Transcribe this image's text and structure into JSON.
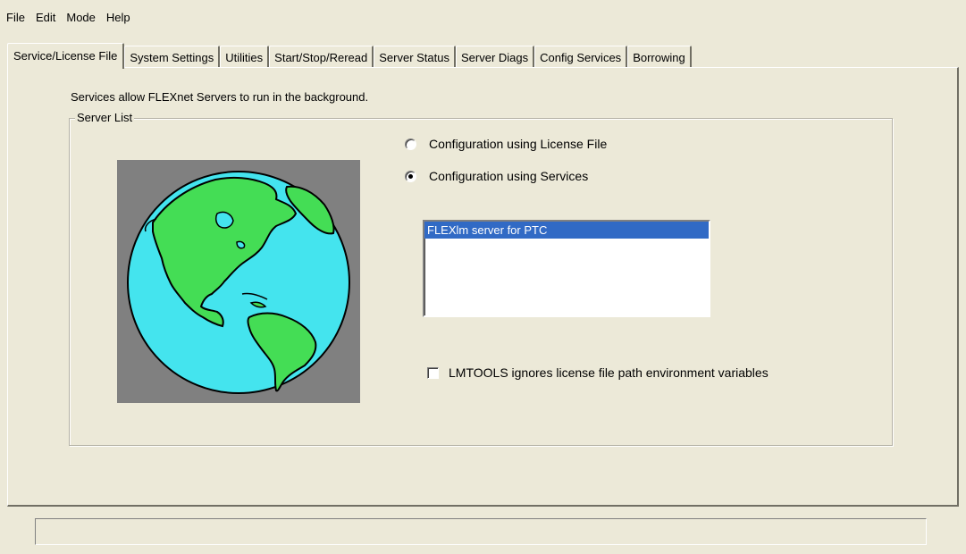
{
  "menu": {
    "file": "File",
    "edit": "Edit",
    "mode": "Mode",
    "help": "Help"
  },
  "tabs": [
    {
      "label": "Service/License File",
      "active": true
    },
    {
      "label": "System Settings",
      "active": false
    },
    {
      "label": "Utilities",
      "active": false
    },
    {
      "label": "Start/Stop/Reread",
      "active": false
    },
    {
      "label": "Server Status",
      "active": false
    },
    {
      "label": "Server Diags",
      "active": false
    },
    {
      "label": "Config Services",
      "active": false
    },
    {
      "label": "Borrowing",
      "active": false
    }
  ],
  "panel": {
    "intro": "Services allow FLEXnet Servers to run in the background.",
    "group_title": "Server List",
    "globe_icon": "globe-icon",
    "radio_license_file": {
      "label": "Configuration using License File",
      "checked": false
    },
    "radio_services": {
      "label": "Configuration using Services",
      "checked": true
    },
    "services_list": [
      {
        "label": "FLEXlm server for PTC",
        "selected": true
      }
    ],
    "ignore_env_checkbox": {
      "label": "LMTOOLS ignores license file path environment variables",
      "checked": false
    }
  },
  "statusbar": {
    "text": ""
  },
  "colors": {
    "window_bg": "#ece9d8",
    "selection_bg": "#316ac5",
    "globe_ocean": "#44e4ee",
    "globe_land": "#44dd55",
    "globe_frame": "#808080"
  }
}
